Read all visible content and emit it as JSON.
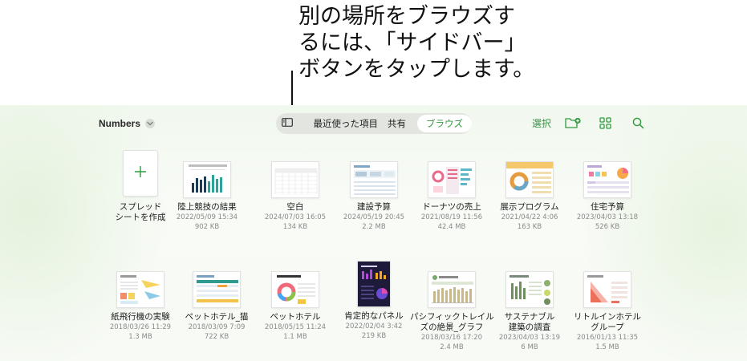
{
  "callout": {
    "lines": [
      "別の場所をブラウズす",
      "るには、「サイドバー」",
      "ボタンをタップします。"
    ]
  },
  "header": {
    "app_title": "Numbers",
    "tabs": {
      "recent": "最近使った項目",
      "shared": "共有",
      "browse": "ブラウズ"
    },
    "select": "選択"
  },
  "colors": {
    "accent": "#2f9a3f",
    "background_tint": "#f1f8ee"
  },
  "icons": [
    "chevron-down-icon",
    "sidebar-icon",
    "new-folder-icon",
    "grid-view-icon",
    "search-icon",
    "plus-icon"
  ],
  "documents": {
    "row1": [
      {
        "name": "スプレッド",
        "name2": "シートを作成",
        "date": "",
        "size": ""
      },
      {
        "name": "陸上競技の結果",
        "date": "2022/05/09 15:34",
        "size": "902 KB"
      },
      {
        "name": "空白",
        "date": "2024/07/03 16:05",
        "size": "134 KB"
      },
      {
        "name": "建設予算",
        "date": "2024/05/19 20:45",
        "size": "2.2 MB"
      },
      {
        "name": "ドーナツの売上",
        "date": "2021/08/19 11:56",
        "size": "42.4 MB"
      },
      {
        "name": "展示プログラム",
        "date": "2021/04/22 4:06",
        "size": "163 KB"
      },
      {
        "name": "住宅予算",
        "date": "2023/04/03 13:18",
        "size": "526 KB"
      }
    ],
    "row2": [
      {
        "name": "紙飛行機の実験",
        "date": "2018/03/26 11:29",
        "size": "1.3 MB"
      },
      {
        "name": "ペットホテル_猫",
        "date": "2018/03/09 7:09",
        "size": "722 KB"
      },
      {
        "name": "ペットホテル",
        "date": "2018/05/15 11:24",
        "size": "1.1 MB"
      },
      {
        "name": "肯定的なパネル",
        "date": "2022/02/04 3:42",
        "size": "219 KB"
      },
      {
        "name": "パシフィックトレイル",
        "name2": "ズの絶景_グラフ",
        "date": "2018/03/16 17:20",
        "size": "2.4 MB"
      },
      {
        "name": "サステナブル",
        "name2": "建築の調査",
        "date": "2023/04/03 13:19",
        "size": "6 MB"
      },
      {
        "name": "リトルインホテル",
        "name2": "グループ",
        "date": "2016/01/13 11:35",
        "size": "1.5 MB"
      }
    ]
  }
}
